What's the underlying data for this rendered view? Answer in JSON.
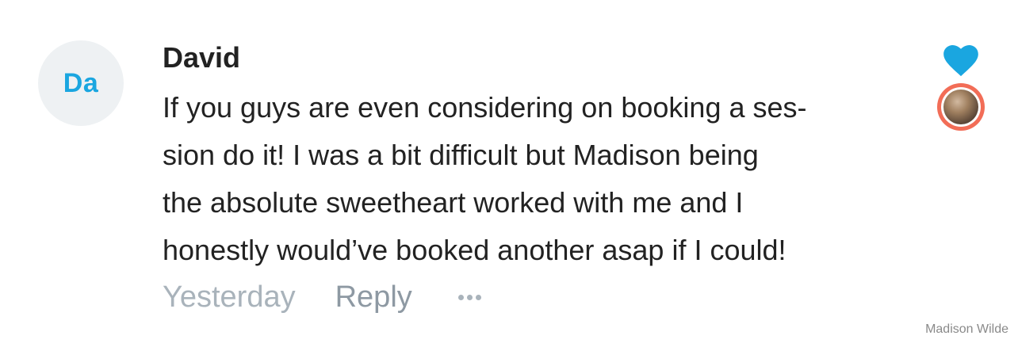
{
  "comment": {
    "avatar_initials": "Da",
    "author": "David",
    "body_lines": [
      "If you guys are even considering on booking a ses-",
      "sion do it! I was a bit difficult but Madison being",
      "the absolute sweetheart worked with me and I",
      "honestly would’ve booked another asap if I could!"
    ],
    "timestamp": "Yesterday",
    "reply_label": "Reply"
  },
  "actions": {
    "like_icon": "heart-icon",
    "more_icon": "ellipsis-icon",
    "liked": true
  },
  "watermark": "Madison Wilde",
  "colors": {
    "initials": "#1aa6e0",
    "heart": "#1aa6e0",
    "liker_ring": "#f26d57",
    "timestamp": "#a9b3bb",
    "reply": "#8e99a3",
    "text": "#222222",
    "avatar_bg": "#eef1f3"
  }
}
